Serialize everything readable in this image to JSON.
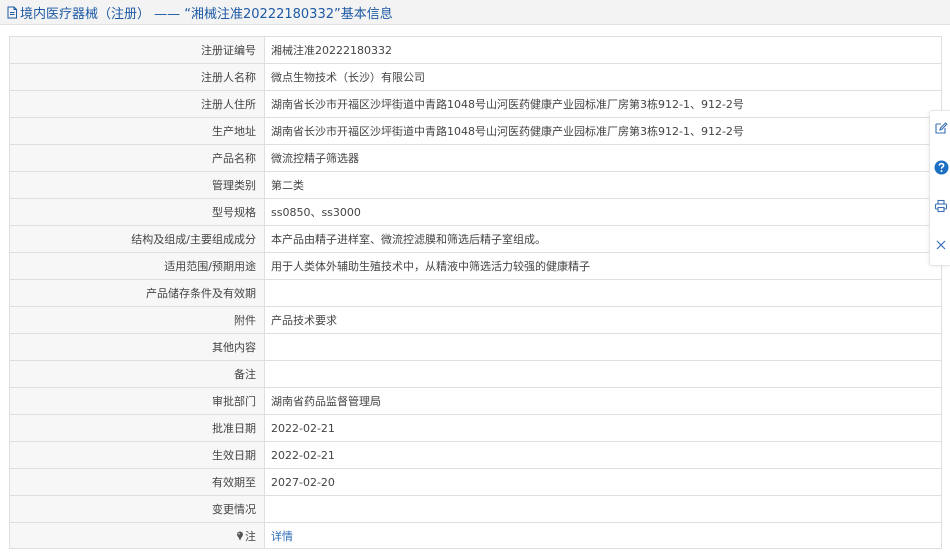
{
  "header": {
    "title": "境内医疗器械（注册） —— “湘械注准20222180332”基本信息",
    "icon": "document-icon"
  },
  "rows": [
    {
      "label": "注册证编号",
      "value": "湘械注准20222180332"
    },
    {
      "label": "注册人名称",
      "value": "微点生物技术（长沙）有限公司"
    },
    {
      "label": "注册人住所",
      "value": "湖南省长沙市开福区沙坪街道中青路1048号山河医药健康产业园标准厂房第3栋912-1、912-2号"
    },
    {
      "label": "生产地址",
      "value": "湖南省长沙市开福区沙坪街道中青路1048号山河医药健康产业园标准厂房第3栋912-1、912-2号"
    },
    {
      "label": "产品名称",
      "value": "微流控精子筛选器"
    },
    {
      "label": "管理类别",
      "value": "第二类"
    },
    {
      "label": "型号规格",
      "value": "ss0850、ss3000"
    },
    {
      "label": "结构及组成/主要组成成分",
      "value": "本产品由精子进样室、微流控滤膜和筛选后精子室组成。"
    },
    {
      "label": "适用范围/预期用途",
      "value": "用于人类体外辅助生殖技术中，从精液中筛选活力较强的健康精子"
    },
    {
      "label": "产品储存条件及有效期",
      "value": ""
    },
    {
      "label": "附件",
      "value": "产品技术要求"
    },
    {
      "label": "其他内容",
      "value": ""
    },
    {
      "label": "备注",
      "value": ""
    },
    {
      "label": "审批部门",
      "value": "湖南省药品监督管理局"
    },
    {
      "label": "批准日期",
      "value": "2022-02-21"
    },
    {
      "label": "生效日期",
      "value": "2022-02-21"
    },
    {
      "label": "有效期至",
      "value": "2027-02-20"
    },
    {
      "label": "变更情况",
      "value": ""
    }
  ],
  "note_row": {
    "label": "注",
    "link_text": "详情",
    "icon": "pin-icon"
  },
  "toolbar": [
    {
      "name": "edit-icon"
    },
    {
      "name": "help-icon"
    },
    {
      "name": "print-icon"
    },
    {
      "name": "close-icon"
    }
  ],
  "colors": {
    "header_text": "#1d5aa5",
    "link": "#2a6bb8",
    "label_bg": "#f7f7f7",
    "border": "#dfdfdf",
    "help_icon": "#1d6fc4"
  }
}
